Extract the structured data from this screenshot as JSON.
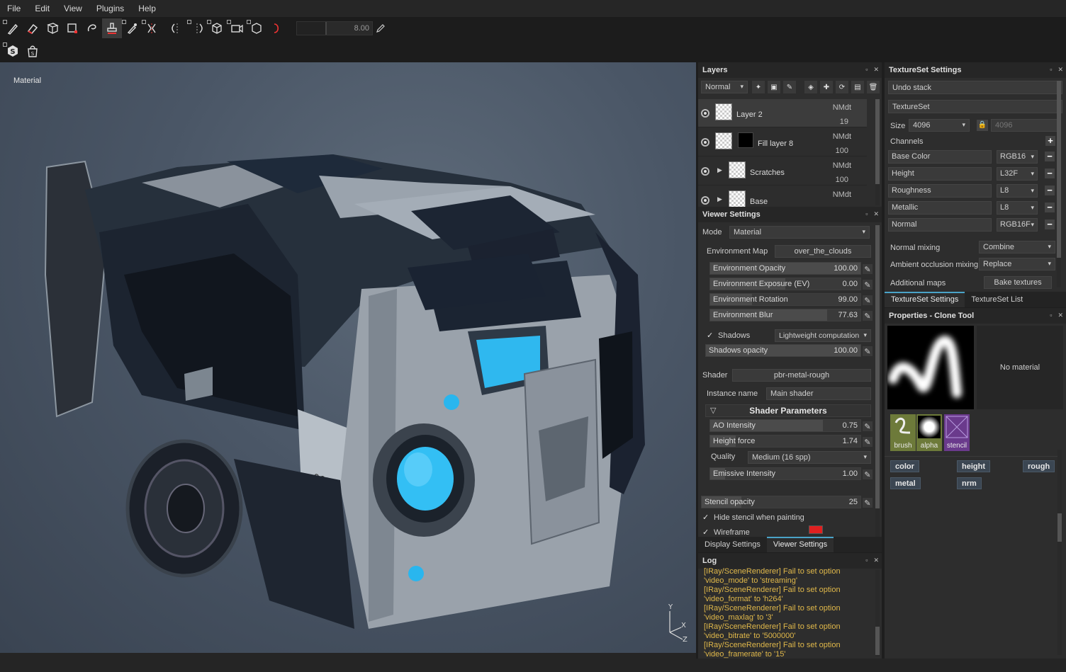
{
  "menubar": {
    "items": [
      "File",
      "Edit",
      "View",
      "Plugins",
      "Help"
    ]
  },
  "toolbar": {
    "tools": [
      "paint-brush",
      "eraser",
      "projection",
      "polygon-fill",
      "smudge",
      "clone-stamp",
      "color-picker",
      "symmetry",
      "mirror-x",
      "mirror-y",
      "camera-a",
      "camera-b",
      "camera-c",
      "cube-view",
      "lasso"
    ],
    "slider_value": "8.00"
  },
  "viewport": {
    "label": "Material",
    "axis": {
      "y": "Y",
      "x": "X",
      "z": "Z"
    }
  },
  "layers": {
    "title": "Layers",
    "blend_mode": "Normal",
    "items": [
      {
        "name": "Layer 2",
        "blend": "NMdt",
        "opacity": "19"
      },
      {
        "name": "Fill layer 8",
        "blend": "NMdt",
        "opacity": "100"
      },
      {
        "name": "Scratches",
        "blend": "NMdt",
        "opacity": "100"
      },
      {
        "name": "Base",
        "blend": "NMdt",
        "opacity": ""
      }
    ]
  },
  "viewer_settings": {
    "title": "Viewer Settings",
    "mode_label": "Mode",
    "mode_value": "Material",
    "env_map_label": "Environment Map",
    "env_map_value": "over_the_clouds",
    "sliders": [
      {
        "label": "Environment Opacity",
        "value": "100.00",
        "fill": 1.0
      },
      {
        "label": "Environment Exposure (EV)",
        "value": "0.00",
        "fill": 0.5
      },
      {
        "label": "Environment Rotation",
        "value": "99.00",
        "fill": 0.28
      },
      {
        "label": "Environment Blur",
        "value": "77.63",
        "fill": 0.78
      }
    ],
    "shadows_label": "Shadows",
    "shadows_mode": "Lightweight computation",
    "shadows_opacity_label": "Shadows opacity",
    "shadows_opacity_value": "100.00",
    "shader_label": "Shader",
    "shader_value": "pbr-metal-rough",
    "instance_label": "Instance name",
    "instance_value": "Main shader",
    "shader_params_title": "Shader Parameters",
    "params": [
      {
        "label": "AO Intensity",
        "value": "0.75",
        "fill": 0.75
      },
      {
        "label": "Height force",
        "value": "1.74",
        "fill": 0.17
      }
    ],
    "quality_label": "Quality",
    "quality_value": "Medium (16 spp)",
    "emissive_label": "Emissive Intensity",
    "emissive_value": "1.00",
    "emissive_fill": 0.1,
    "stencil_label": "Stencil opacity",
    "stencil_value": "25",
    "stencil_fill": 0.25,
    "hide_stencil_label": "Hide stencil when painting",
    "wireframe_label": "Wireframe",
    "wireframe_color": "#e02020"
  },
  "bottom_tabs": [
    "Display Settings",
    "Viewer Settings"
  ],
  "log": {
    "title": "Log",
    "lines": [
      "[IRay/SceneRenderer] Fail to set option",
      "'video_mode' to 'streaming'",
      "[IRay/SceneRenderer] Fail to set option",
      "'video_format' to 'h264'",
      "[IRay/SceneRenderer] Fail to set option",
      "'video_maxlag' to '3'",
      "[IRay/SceneRenderer] Fail to set option",
      "'video_bitrate' to '5000000'",
      "[IRay/SceneRenderer] Fail to set option",
      "'video_framerate' to '15'"
    ]
  },
  "texture_set": {
    "title": "TextureSet Settings",
    "undo_stack": "Undo stack",
    "texture_set": "TextureSet",
    "size_label": "Size",
    "size_value": "4096",
    "size_value2": "4096",
    "channels_label": "Channels",
    "channels": [
      {
        "name": "Base Color",
        "format": "RGB16"
      },
      {
        "name": "Height",
        "format": "L32F"
      },
      {
        "name": "Roughness",
        "format": "L8"
      },
      {
        "name": "Metallic",
        "format": "L8"
      },
      {
        "name": "Normal",
        "format": "RGB16F"
      }
    ],
    "normal_mixing_label": "Normal mixing",
    "normal_mixing_value": "Combine",
    "ao_mixing_label": "Ambient occlusion mixing",
    "ao_mixing_value": "Replace",
    "additional_maps_label": "Additional maps",
    "bake_label": "Bake textures"
  },
  "right_tabs": [
    "TextureSet Settings",
    "TextureSet List"
  ],
  "properties": {
    "title": "Properties - Clone Tool",
    "no_material": "No material",
    "slots": [
      "brush",
      "alpha",
      "stencil"
    ],
    "channels": [
      "color",
      "height",
      "rough",
      "metal",
      "nrm"
    ]
  }
}
